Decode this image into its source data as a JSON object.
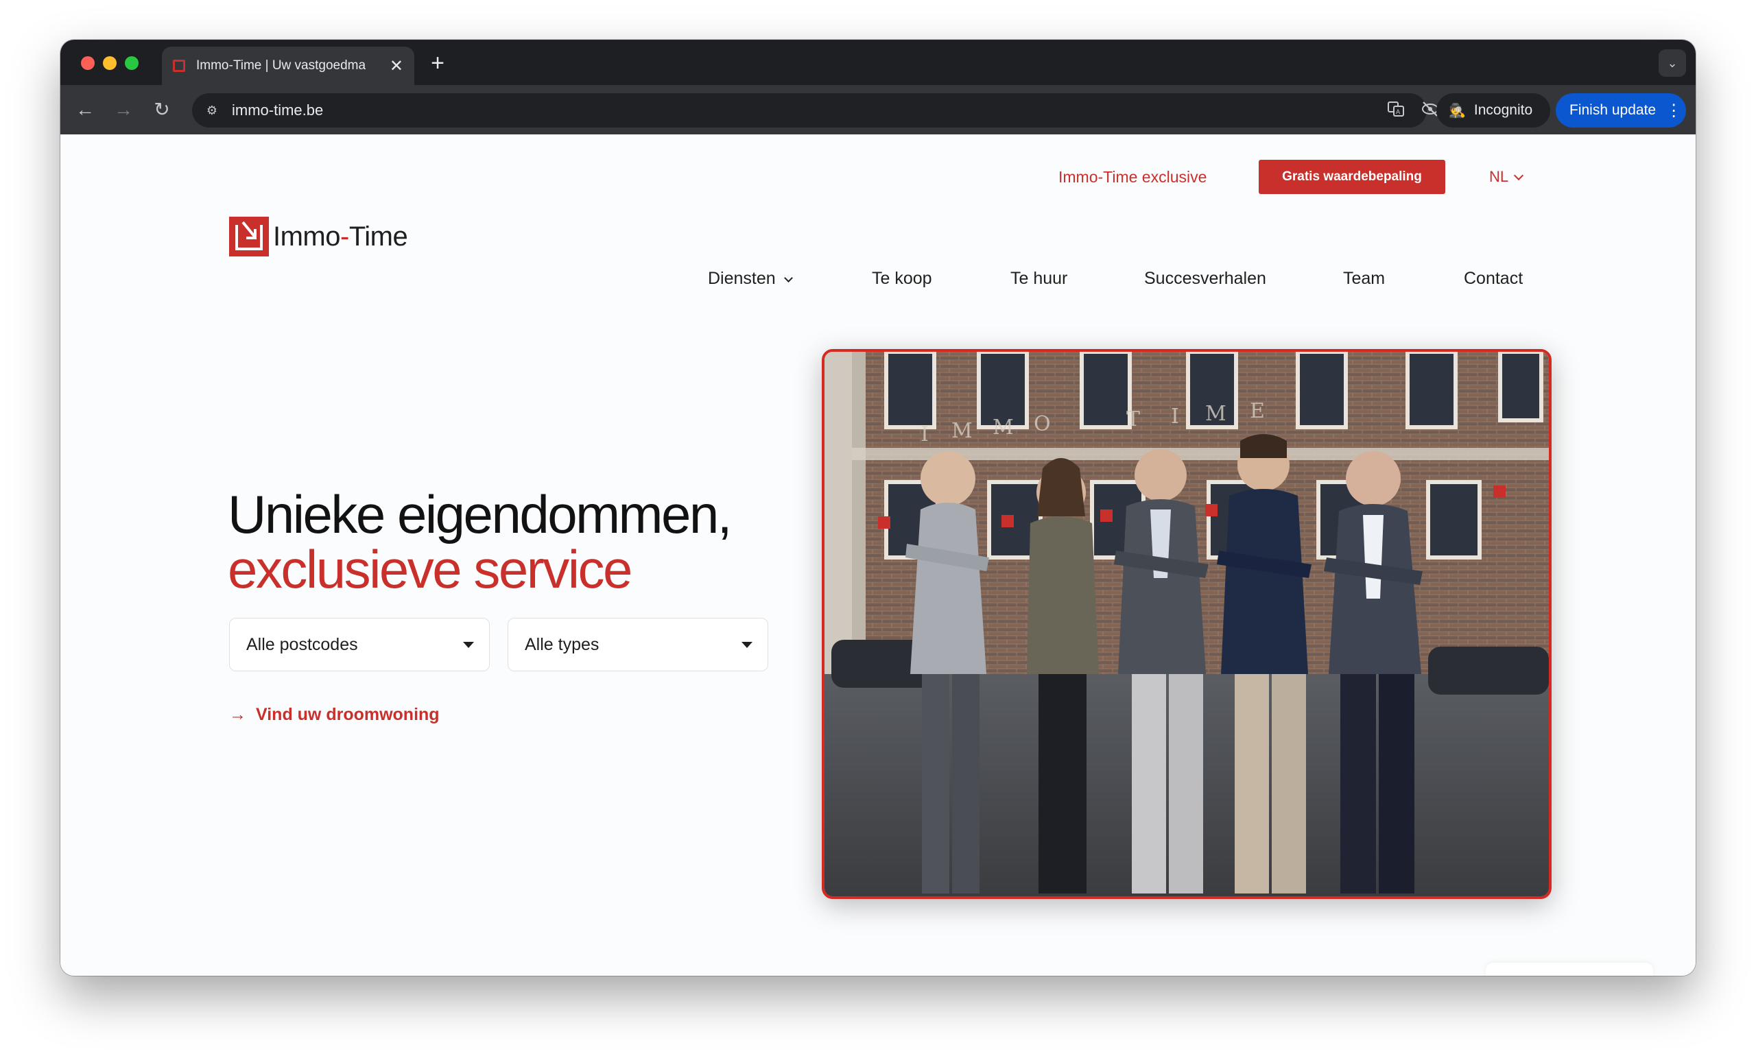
{
  "browser": {
    "tab_title": "Immo-Time | Uw vastgoedma",
    "tab_close": "✕",
    "new_tab": "+",
    "tab_menu": "⌄",
    "back": "←",
    "forward": "→",
    "reload": "↻",
    "url": "immo-time.be",
    "incognito_label": "Incognito",
    "finish_update_label": "Finish update",
    "colors": {
      "tabstrip": "#1e1f22",
      "toolbar": "#35363a",
      "update_button": "#0b57d0"
    }
  },
  "site": {
    "top_link": "Immo-Time exclusive",
    "cta_button": "Gratis waardebepaling",
    "language": "NL",
    "logo": {
      "word1": "Immo",
      "dash": "-",
      "word2": "Time"
    },
    "nav": {
      "diensten": "Diensten",
      "te_koop": "Te koop",
      "te_huur": "Te huur",
      "succesverhalen": "Succesverhalen",
      "team": "Team",
      "contact": "Contact"
    },
    "hero": {
      "title_line1": "Unieke eigendommen,",
      "title_line2": "exclusieve service"
    },
    "search": {
      "postcode_value": "Alle postcodes",
      "type_value": "Alle types",
      "find_link": "Vind uw droomwoning"
    },
    "accent_color": "#c9302c"
  }
}
